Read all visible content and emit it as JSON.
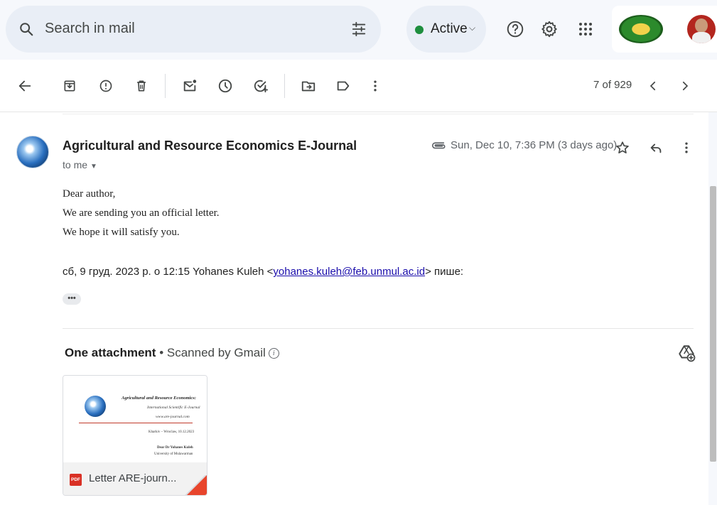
{
  "search": {
    "placeholder": "Search in mail"
  },
  "status": {
    "label": "Active",
    "color": "#1e8e3e"
  },
  "header_icons": [
    "help-icon",
    "settings-gear-icon",
    "apps-grid-icon"
  ],
  "toolbar": {
    "icons": [
      "back-arrow-icon",
      "archive-icon",
      "report-spam-icon",
      "delete-trash-icon",
      "mark-unread-icon",
      "snooze-clock-icon",
      "add-to-tasks-icon",
      "move-to-folder-icon",
      "label-icon",
      "more-vertical-icon"
    ],
    "pager": "7 of 929"
  },
  "message": {
    "sender": "Agricultural and Resource Economics E-Journal",
    "recipient": "to me",
    "date": "Sun, Dec 10, 7:36 PM (3 days ago)",
    "body": [
      "Dear author,",
      "We are sending you an official letter.",
      "We hope it will satisfy you."
    ],
    "quote_prefix": "сб, 9 груд. 2023 р. о 12:15 Yohanes Kuleh <",
    "quote_email": "yohanes.kuleh@feb.unmul.ac.id",
    "quote_suffix": "> пише:",
    "trimmed_label": "•••"
  },
  "attachments": {
    "title": "One attachment",
    "separator": " • ",
    "scan_note": "Scanned by Gmail",
    "info_glyph": "i",
    "file": {
      "name": "Letter ARE-journ...",
      "type_badge": "PDF",
      "preview": {
        "line1": "Agricultural and Resource Economics:",
        "line2": "International Scientific E-Journal",
        "line3": "www.are-journal.com",
        "line4": "Kharkiv – Wroclaw, 10.12.2023",
        "line5": "Dear Dr Yohanes Kuleh",
        "line6": "University of Mulawarman"
      }
    }
  }
}
